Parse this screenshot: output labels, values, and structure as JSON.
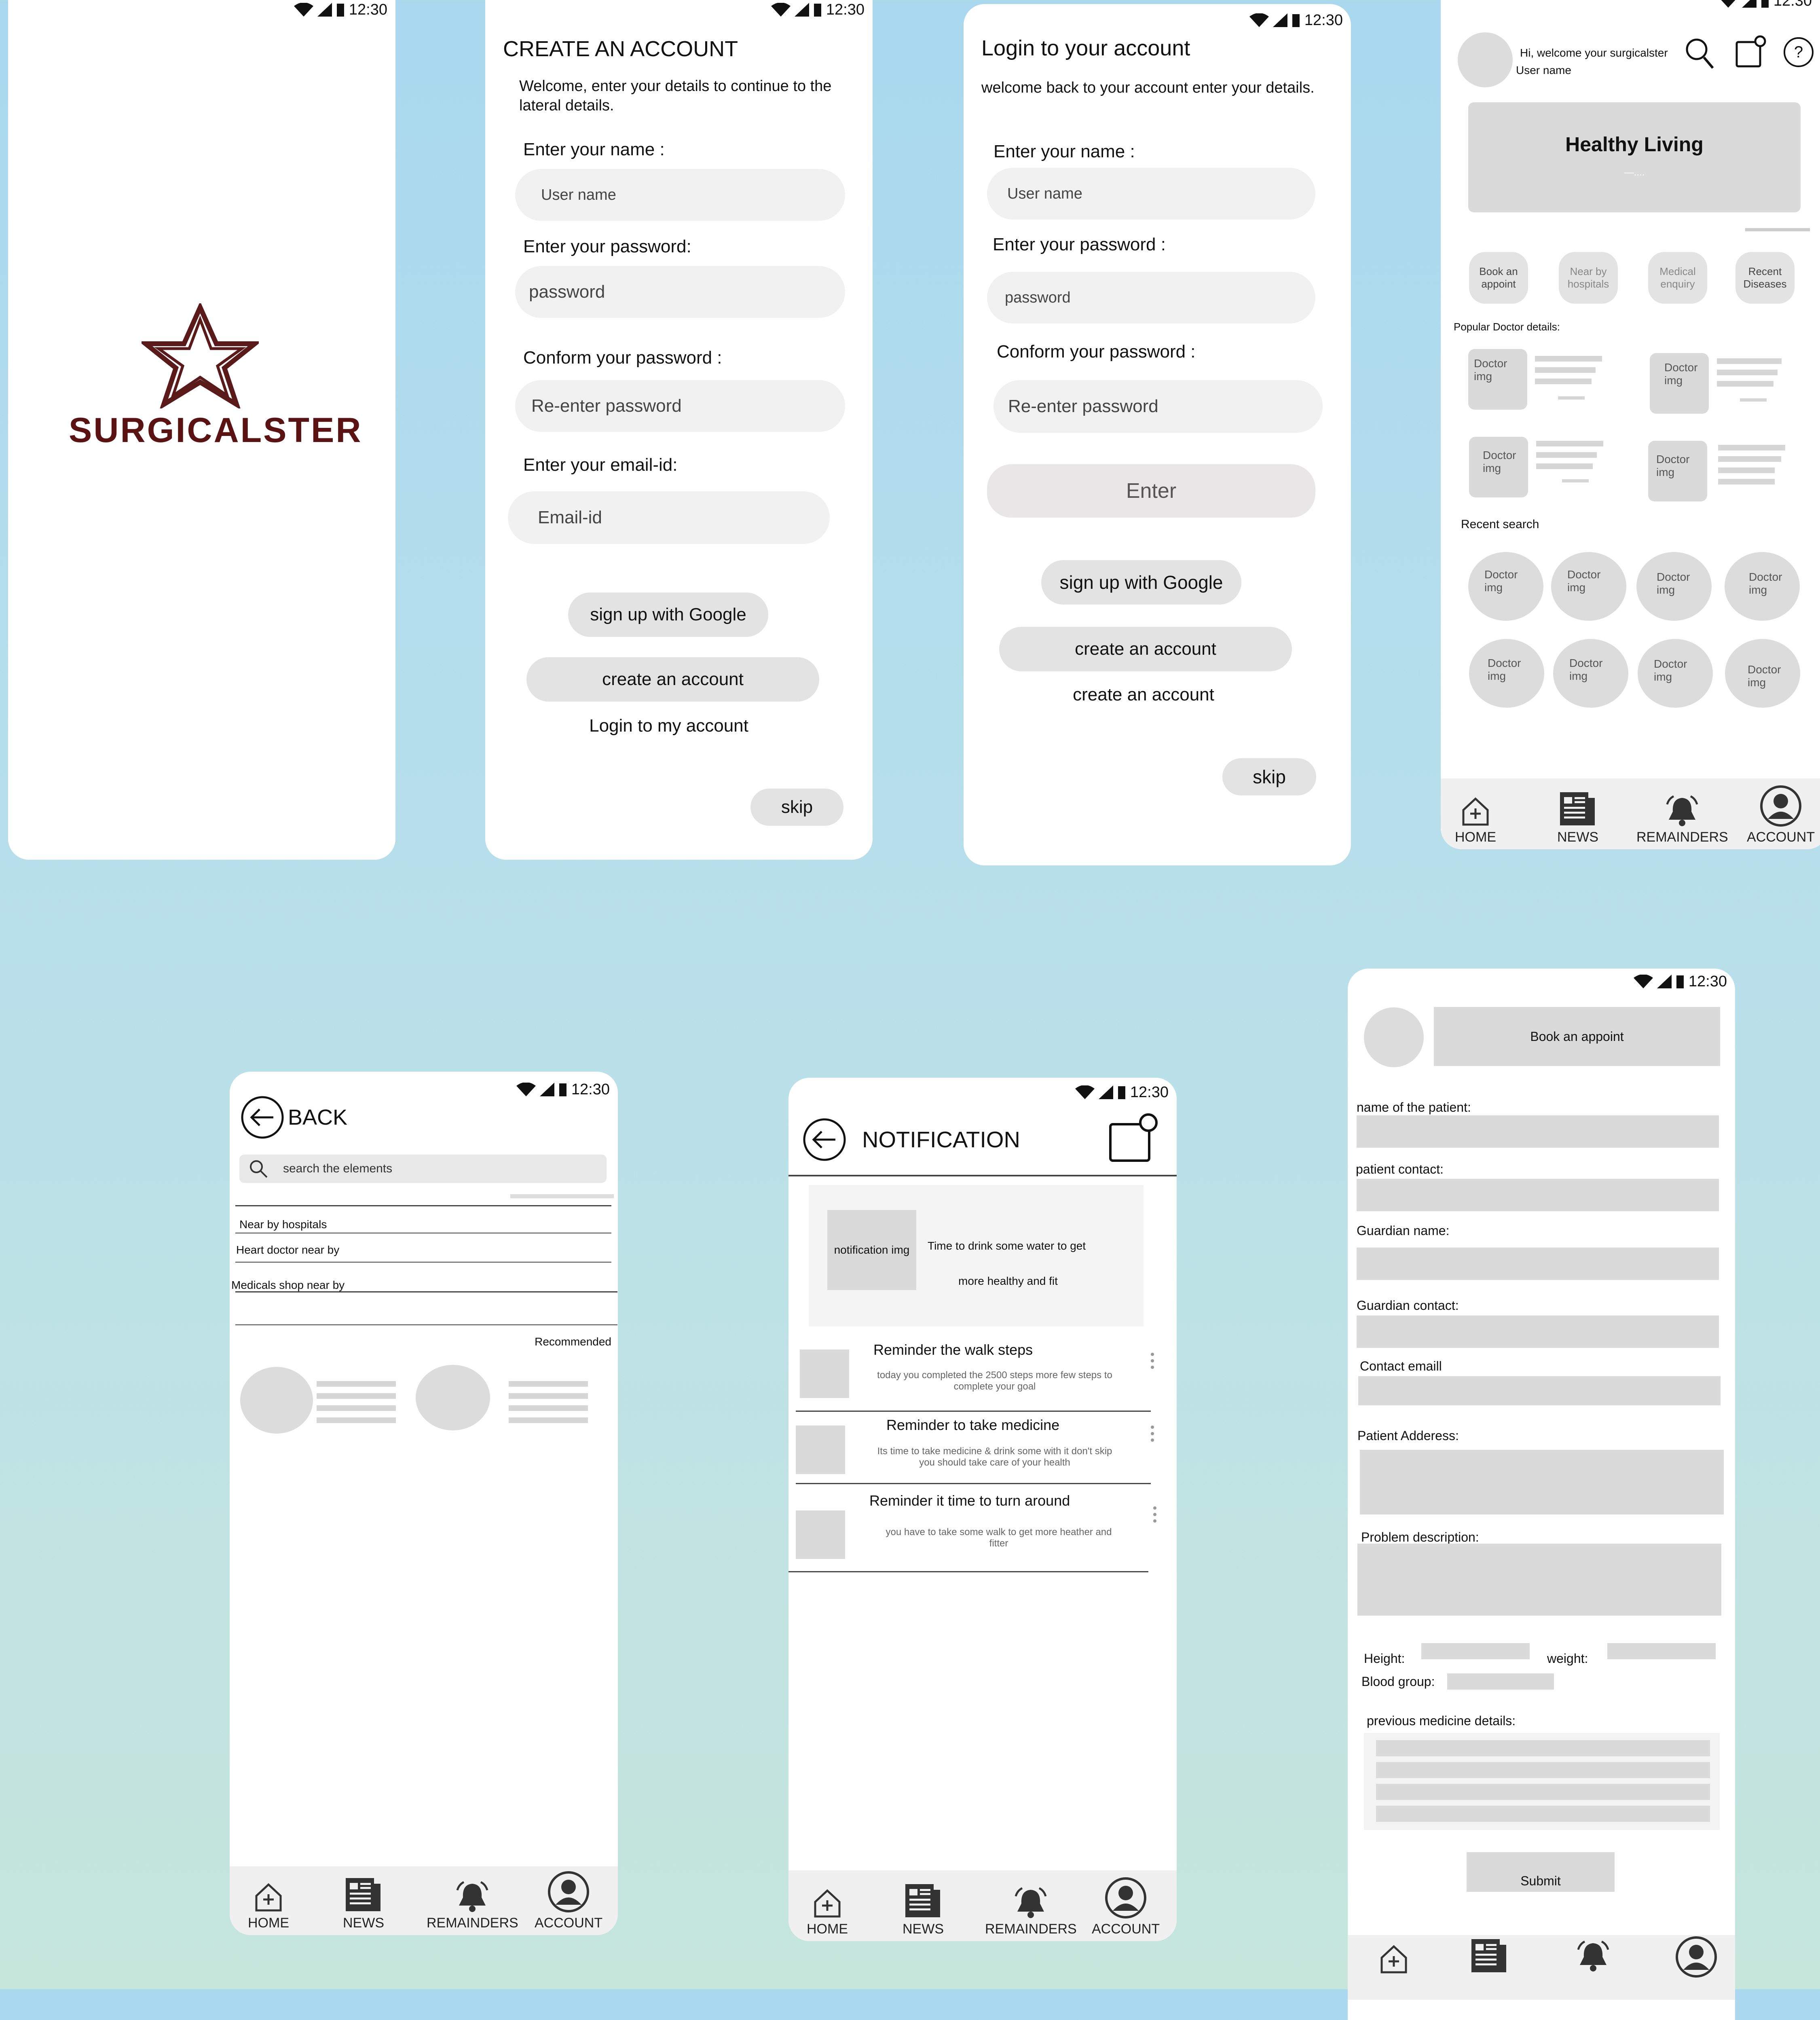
{
  "status_time": "12:30",
  "splash": {
    "brand": "SURGICALSTER"
  },
  "create_account": {
    "title": "CREATE AN ACCOUNT",
    "subtitle": "Welcome, enter your details to continue to the lateral details.",
    "name_label": "Enter your name :",
    "name_placeholder": "User name",
    "password_label": "Enter your password:",
    "password_placeholder": "password",
    "confirm_label": "Conform your password :",
    "confirm_placeholder": "Re-enter password",
    "email_label": "Enter your email-id:",
    "email_placeholder": "Email-id",
    "google_button": "sign up with Google",
    "create_button": "create an account",
    "login_link": "Login to my account",
    "skip_button": "skip"
  },
  "login": {
    "title": "Login to your account",
    "subtitle": "welcome back to your account enter your details.",
    "name_label": "Enter your name :",
    "name_placeholder": "User name",
    "password_label": "Enter your password :",
    "password_placeholder": "password",
    "confirm_label": "Conform your password :",
    "confirm_placeholder": "Re-enter password",
    "enter_button": "Enter",
    "google_button": "sign up with Google",
    "create_button": "create an account",
    "create_link": "create an account",
    "skip_button": "skip"
  },
  "home": {
    "greeting": "Hi, welcome your surgicalster",
    "username": "User name",
    "banner_title": "Healthy Living",
    "banner_dots": "—....",
    "quick_actions": [
      {
        "line1": "Book an",
        "line2": "appoint"
      },
      {
        "line1": "Near by",
        "line2": "hospitals"
      },
      {
        "line1": "Medical",
        "line2": "enquiry"
      },
      {
        "line1": "Recent",
        "line2": "Diseases"
      }
    ],
    "popular_heading": "Popular Doctor details:",
    "doctor_line1": "Doctor",
    "doctor_line2": "img",
    "recent_heading": "Recent search"
  },
  "nav": {
    "home": "HOME",
    "news": "NEWS",
    "reminders": "REMAINDERS",
    "account": "ACCOUNT"
  },
  "search": {
    "back_label": "BACK",
    "search_placeholder": "search the elements",
    "suggestions": [
      "Near by hospitals",
      "Heart doctor near by",
      "Medicals shop  near by"
    ],
    "recommended": "Recommended"
  },
  "notification": {
    "title": "NOTIFICATION",
    "featured_img": "notification img",
    "featured_line1": "Time to drink some water to get",
    "featured_line2": "more healthy and fit",
    "items": [
      {
        "title": "Reminder the walk steps",
        "body1": "today you completed the 2500 steps  more few steps to",
        "body2": "complete your goal"
      },
      {
        "title": "Reminder to take medicine",
        "body1": "Its time to take medicine & drink some with it don't skip",
        "body2": "you should take care of your health"
      },
      {
        "title": "Reminder it time to turn around",
        "body1": "you have to take some walk to get more heather and",
        "body2": "fitter"
      }
    ]
  },
  "booking": {
    "header": "Book an  appoint",
    "patient_name": "name of the patient:",
    "patient_contact": "patient contact:",
    "guardian_name": "Guardian name:",
    "guardian_contact": "Guardian contact:",
    "contact_email": "Contact emaill",
    "patient_address": "Patient Adderess:",
    "problem_description": "Problem description:",
    "height": "Height:",
    "weight": "weight:",
    "blood_group": "Blood group:",
    "previous_medicine": "previous medicine details:",
    "submit": "Submit"
  }
}
